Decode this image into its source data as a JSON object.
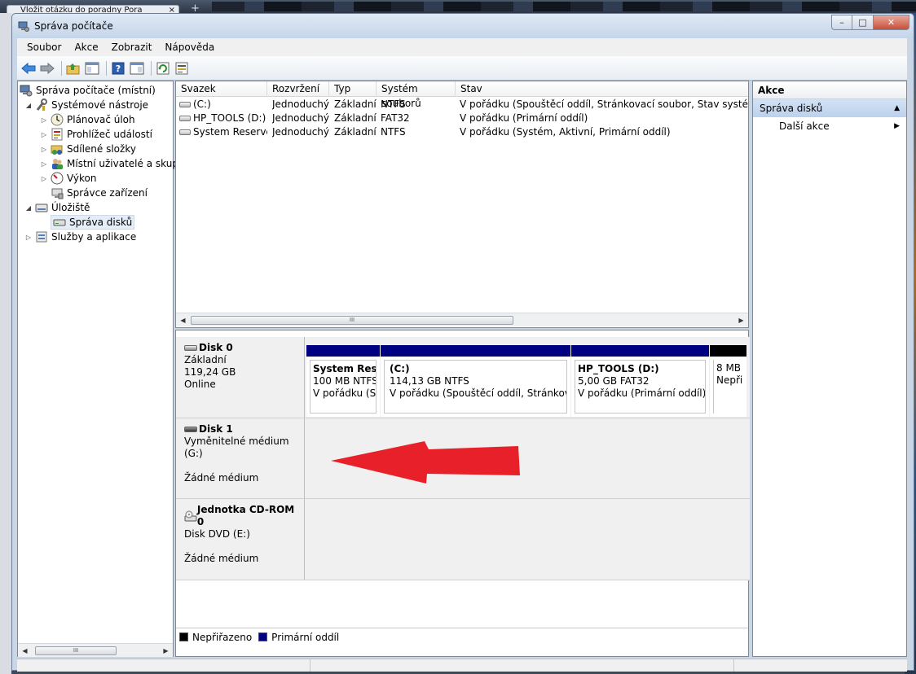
{
  "background": {
    "tab_title": "Vložit otázku do poradny Pora",
    "tab_close": "×",
    "new_tab": "+"
  },
  "window": {
    "title": "Správa počítače",
    "buttons": {
      "minimize": "–",
      "maximize": "□",
      "close": "✕"
    }
  },
  "menu": [
    "Soubor",
    "Akce",
    "Zobrazit",
    "Nápověda"
  ],
  "tree": {
    "root": "Správa počítače (místní)",
    "items": [
      {
        "label": "Systémové nástroje",
        "level": 1,
        "expander": "◢",
        "icon": "tools-icon"
      },
      {
        "label": "Plánovač úloh",
        "level": 2,
        "expander": "▷",
        "icon": "clock-icon"
      },
      {
        "label": "Prohlížeč událostí",
        "level": 2,
        "expander": "▷",
        "icon": "event-viewer-icon"
      },
      {
        "label": "Sdílené složky",
        "level": 2,
        "expander": "▷",
        "icon": "shared-folder-icon"
      },
      {
        "label": "Místní uživatelé a skupiny",
        "level": 2,
        "expander": "▷",
        "icon": "users-icon"
      },
      {
        "label": "Výkon",
        "level": 2,
        "expander": "▷",
        "icon": "performance-icon"
      },
      {
        "label": "Správce zařízení",
        "level": 2,
        "expander": "",
        "icon": "device-manager-icon"
      },
      {
        "label": "Úložiště",
        "level": 1,
        "expander": "◢",
        "icon": "storage-icon"
      },
      {
        "label": "Správa disků",
        "level": 2,
        "expander": "",
        "icon": "disk-management-icon",
        "selected": true
      },
      {
        "label": "Služby a aplikace",
        "level": 1,
        "expander": "▷",
        "icon": "services-icon"
      }
    ]
  },
  "volumes": {
    "headers": [
      "Svazek",
      "Rozvržení",
      "Typ",
      "Systém souborů",
      "Stav"
    ],
    "rows": [
      [
        "(C:)",
        "Jednoduchý",
        "Základní",
        "NTFS",
        "V pořádku (Spouštěcí oddíl, Stránkovací soubor, Stav systému, Primární oddíl)"
      ],
      [
        "HP_TOOLS (D:)",
        "Jednoduchý",
        "Základní",
        "FAT32",
        "V pořádku (Primární oddíl)"
      ],
      [
        "System Reserved",
        "Jednoduchý",
        "Základní",
        "NTFS",
        "V pořádku (Systém, Aktivní, Primární oddíl)"
      ]
    ],
    "scroll_grip": "III"
  },
  "disks": [
    {
      "name": "Disk 0",
      "type": "Základní",
      "size": "119,24 GB",
      "status": "Online",
      "partitions": [
        {
          "name": "System Reser",
          "size": "100 MB NTFS",
          "status": "V pořádku (Sys",
          "color": "#000080"
        },
        {
          "name": "(C:)",
          "size": "114,13 GB NTFS",
          "status": "V pořádku (Spouštěcí oddíl, Stránkovací s",
          "color": "#000080"
        },
        {
          "name": "HP_TOOLS  (D:)",
          "size": "5,00 GB FAT32",
          "status": "V pořádku (Primární oddíl)",
          "color": "#000080"
        },
        {
          "name": "",
          "size": "8 MB",
          "status": "Nepři",
          "color": "#000000"
        }
      ]
    },
    {
      "name": "Disk 1",
      "line1": "Vyměnitelné médium (G:)",
      "line2": "Žádné médium"
    },
    {
      "name": "Jednotka CD-ROM 0",
      "line1": "Disk DVD (E:)",
      "line2": "Žádné médium"
    }
  ],
  "legend": [
    {
      "label": "Nepřiřazeno",
      "color": "#000000"
    },
    {
      "label": "Primární oddíl",
      "color": "#000080"
    }
  ],
  "actions": {
    "header": "Akce",
    "section": "Správa disků",
    "section_arrow": "▲",
    "item": "Další akce",
    "item_arrow": "▶"
  },
  "arrow_color": "#e8202a"
}
